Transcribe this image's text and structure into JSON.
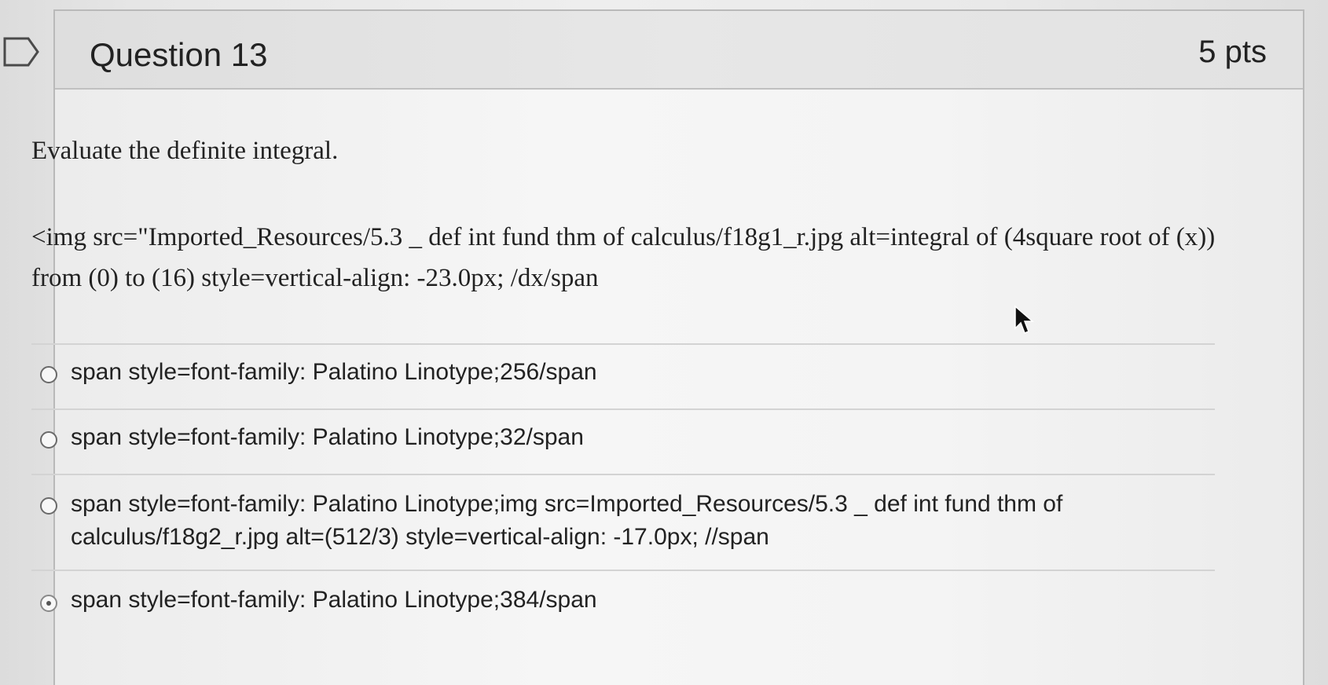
{
  "question": {
    "title": "Question 13",
    "points": "5 pts",
    "prompt": "Evaluate the definite integral.",
    "body": "<img src=\"Imported_Resources/5.3 _ def int fund thm of calculus/f18g1_r.jpg alt=integral of (4square root of (x)) from (0) to (16) style=vertical-align: -23.0px; /dx/span"
  },
  "answers": [
    {
      "label": "span style=font-family: Palatino Linotype;256/span",
      "selected": false
    },
    {
      "label": "span style=font-family: Palatino Linotype;32/span",
      "selected": false
    },
    {
      "label": "span style=font-family: Palatino Linotype;img src=Imported_Resources/5.3 _ def int fund thm of calculus/f18g2_r.jpg alt=(512/3) style=vertical-align: -17.0px; //span",
      "selected": false
    },
    {
      "label": "span style=font-family: Palatino Linotype;384/span",
      "selected": true
    }
  ],
  "icons": {
    "flag": "flag-icon",
    "cursor": "mouse-pointer-icon",
    "radio": "radio-button-icon"
  }
}
